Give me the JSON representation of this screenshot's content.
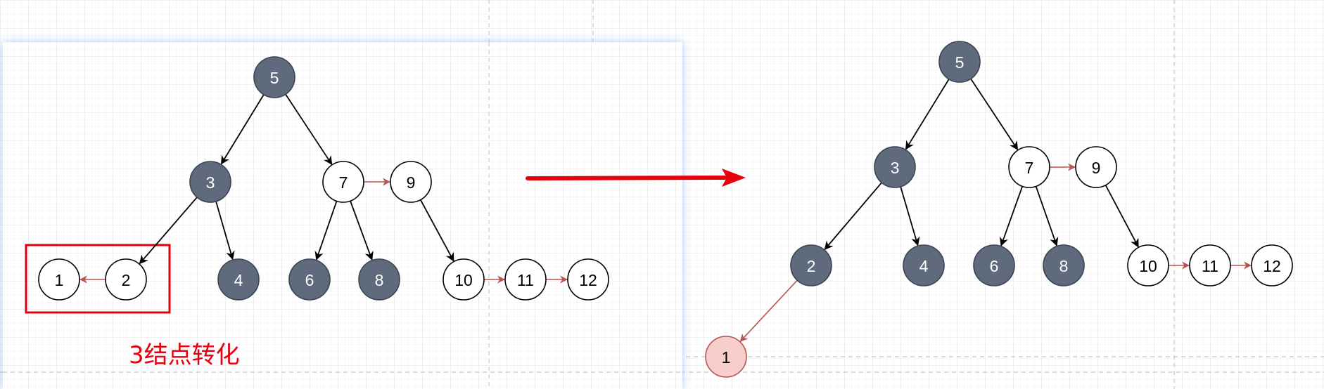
{
  "colors": {
    "dark_node": "#5f6b7c",
    "light_node": "#ffffff",
    "highlight_node": "#f8cecc",
    "highlight_stroke": "#b85450",
    "red_edge": "#b85450",
    "black_edge": "#000000",
    "selection_box": "#e0000b",
    "arrow": "#e8000b",
    "caption": "#e60012",
    "grid": "#e6e6e6",
    "selection_glow": "#9ec2ff"
  },
  "caption": {
    "text": "3结点转化"
  },
  "before_tree": {
    "nodes": [
      {
        "id": "b5",
        "label": "5",
        "style": "dark"
      },
      {
        "id": "b3",
        "label": "3",
        "style": "dark"
      },
      {
        "id": "b7",
        "label": "7",
        "style": "light"
      },
      {
        "id": "b9",
        "label": "9",
        "style": "light"
      },
      {
        "id": "b1",
        "label": "1",
        "style": "light"
      },
      {
        "id": "b2",
        "label": "2",
        "style": "light"
      },
      {
        "id": "b4",
        "label": "4",
        "style": "dark"
      },
      {
        "id": "b6",
        "label": "6",
        "style": "dark"
      },
      {
        "id": "b8",
        "label": "8",
        "style": "dark"
      },
      {
        "id": "b10",
        "label": "10",
        "style": "light"
      },
      {
        "id": "b11",
        "label": "11",
        "style": "light"
      },
      {
        "id": "b12",
        "label": "12",
        "style": "light"
      }
    ],
    "edges": [
      {
        "from": "b5",
        "to": "b3",
        "color": "black"
      },
      {
        "from": "b5",
        "to": "b7",
        "color": "black"
      },
      {
        "from": "b3",
        "to": "b2",
        "color": "black"
      },
      {
        "from": "b3",
        "to": "b4",
        "color": "black"
      },
      {
        "from": "b2",
        "to": "b1",
        "color": "red"
      },
      {
        "from": "b7",
        "to": "b9",
        "color": "red"
      },
      {
        "from": "b7",
        "to": "b6",
        "color": "black"
      },
      {
        "from": "b7",
        "to": "b8",
        "color": "black"
      },
      {
        "from": "b9",
        "to": "b10",
        "color": "black"
      },
      {
        "from": "b10",
        "to": "b11",
        "color": "red"
      },
      {
        "from": "b11",
        "to": "b12",
        "color": "red"
      }
    ]
  },
  "after_tree": {
    "nodes": [
      {
        "id": "a5",
        "label": "5",
        "style": "dark"
      },
      {
        "id": "a3",
        "label": "3",
        "style": "dark"
      },
      {
        "id": "a7",
        "label": "7",
        "style": "light"
      },
      {
        "id": "a9",
        "label": "9",
        "style": "light"
      },
      {
        "id": "a2",
        "label": "2",
        "style": "dark"
      },
      {
        "id": "a4",
        "label": "4",
        "style": "dark"
      },
      {
        "id": "a6",
        "label": "6",
        "style": "dark"
      },
      {
        "id": "a8",
        "label": "8",
        "style": "dark"
      },
      {
        "id": "a10",
        "label": "10",
        "style": "light"
      },
      {
        "id": "a11",
        "label": "11",
        "style": "light"
      },
      {
        "id": "a12",
        "label": "12",
        "style": "light"
      },
      {
        "id": "a1",
        "label": "1",
        "style": "highlight"
      }
    ],
    "edges": [
      {
        "from": "a5",
        "to": "a3",
        "color": "black"
      },
      {
        "from": "a5",
        "to": "a7",
        "color": "black"
      },
      {
        "from": "a3",
        "to": "a2",
        "color": "black"
      },
      {
        "from": "a3",
        "to": "a4",
        "color": "black"
      },
      {
        "from": "a2",
        "to": "a1",
        "color": "red"
      },
      {
        "from": "a7",
        "to": "a9",
        "color": "red"
      },
      {
        "from": "a7",
        "to": "a6",
        "color": "black"
      },
      {
        "from": "a7",
        "to": "a8",
        "color": "black"
      },
      {
        "from": "a9",
        "to": "a10",
        "color": "black"
      },
      {
        "from": "a10",
        "to": "a11",
        "color": "red"
      },
      {
        "from": "a11",
        "to": "a12",
        "color": "red"
      }
    ]
  }
}
